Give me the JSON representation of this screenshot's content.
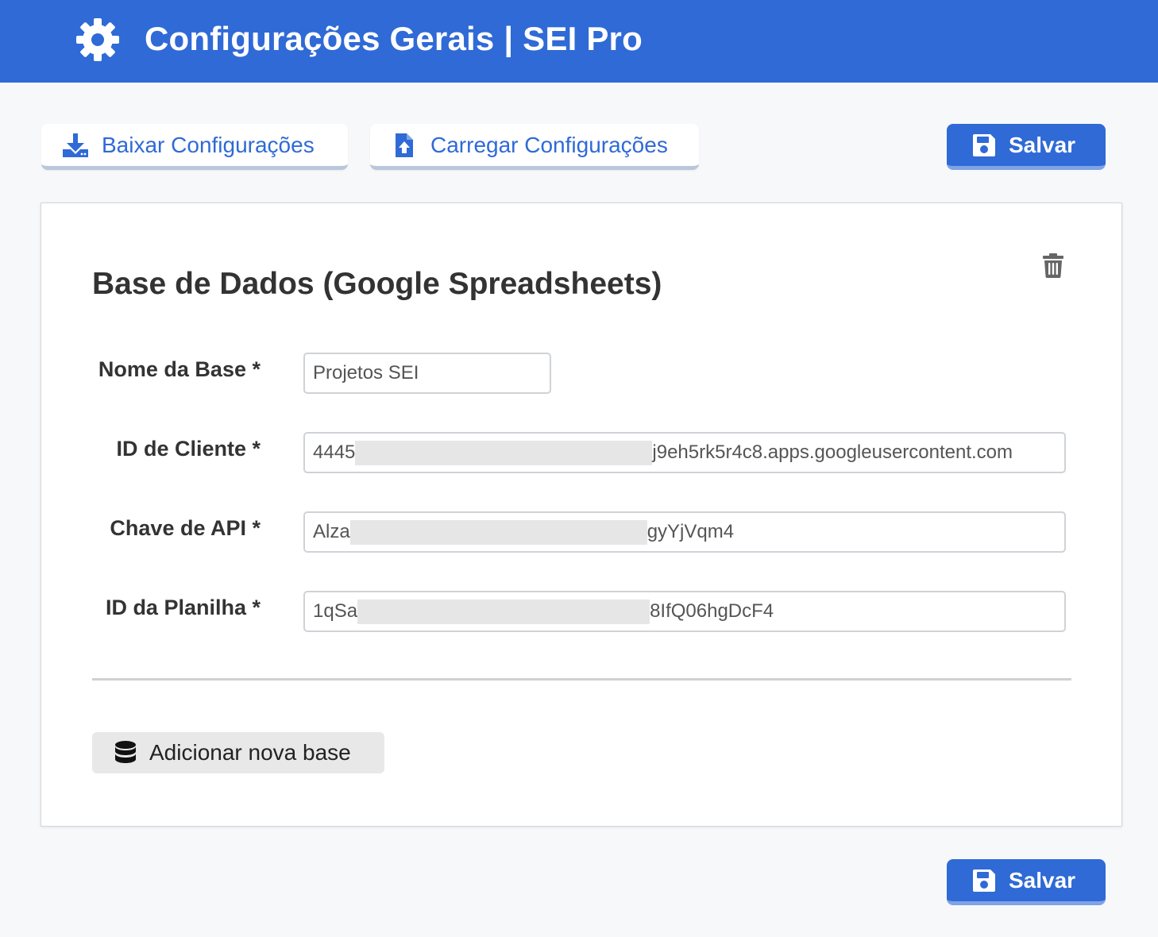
{
  "header": {
    "icon": "gear-icon",
    "title": "Configurações Gerais | SEI Pro"
  },
  "toolbar": {
    "download_label": "Baixar Configurações",
    "download_icon": "download-icon",
    "upload_label": "Carregar Configurações",
    "upload_icon": "file-upload-icon",
    "save_label": "Salvar",
    "save_icon": "floppy-disk-icon"
  },
  "card": {
    "title": "Base de Dados (Google Spreadsheets)",
    "delete_icon": "trash-icon",
    "fields": {
      "base_name": {
        "label": "Nome da Base *",
        "value": "Projetos SEI"
      },
      "client_id": {
        "label": "ID de Cliente *",
        "prefix": "4445",
        "suffix": "j9eh5rk5r4c8.apps.googleusercontent.com"
      },
      "api_key": {
        "label": "Chave de API *",
        "prefix": "Alza",
        "suffix": "gyYjVqm4"
      },
      "sheet_id": {
        "label": "ID da Planilha *",
        "prefix": "1qSa",
        "suffix": "8IfQ06hgDcF4"
      }
    },
    "add_base_label": "Adicionar nova base",
    "add_base_icon": "database-icon"
  },
  "footer": {
    "save_label": "Salvar"
  },
  "colors": {
    "accent": "#2f6ad6",
    "background": "#f7f8fa",
    "card": "#ffffff"
  }
}
